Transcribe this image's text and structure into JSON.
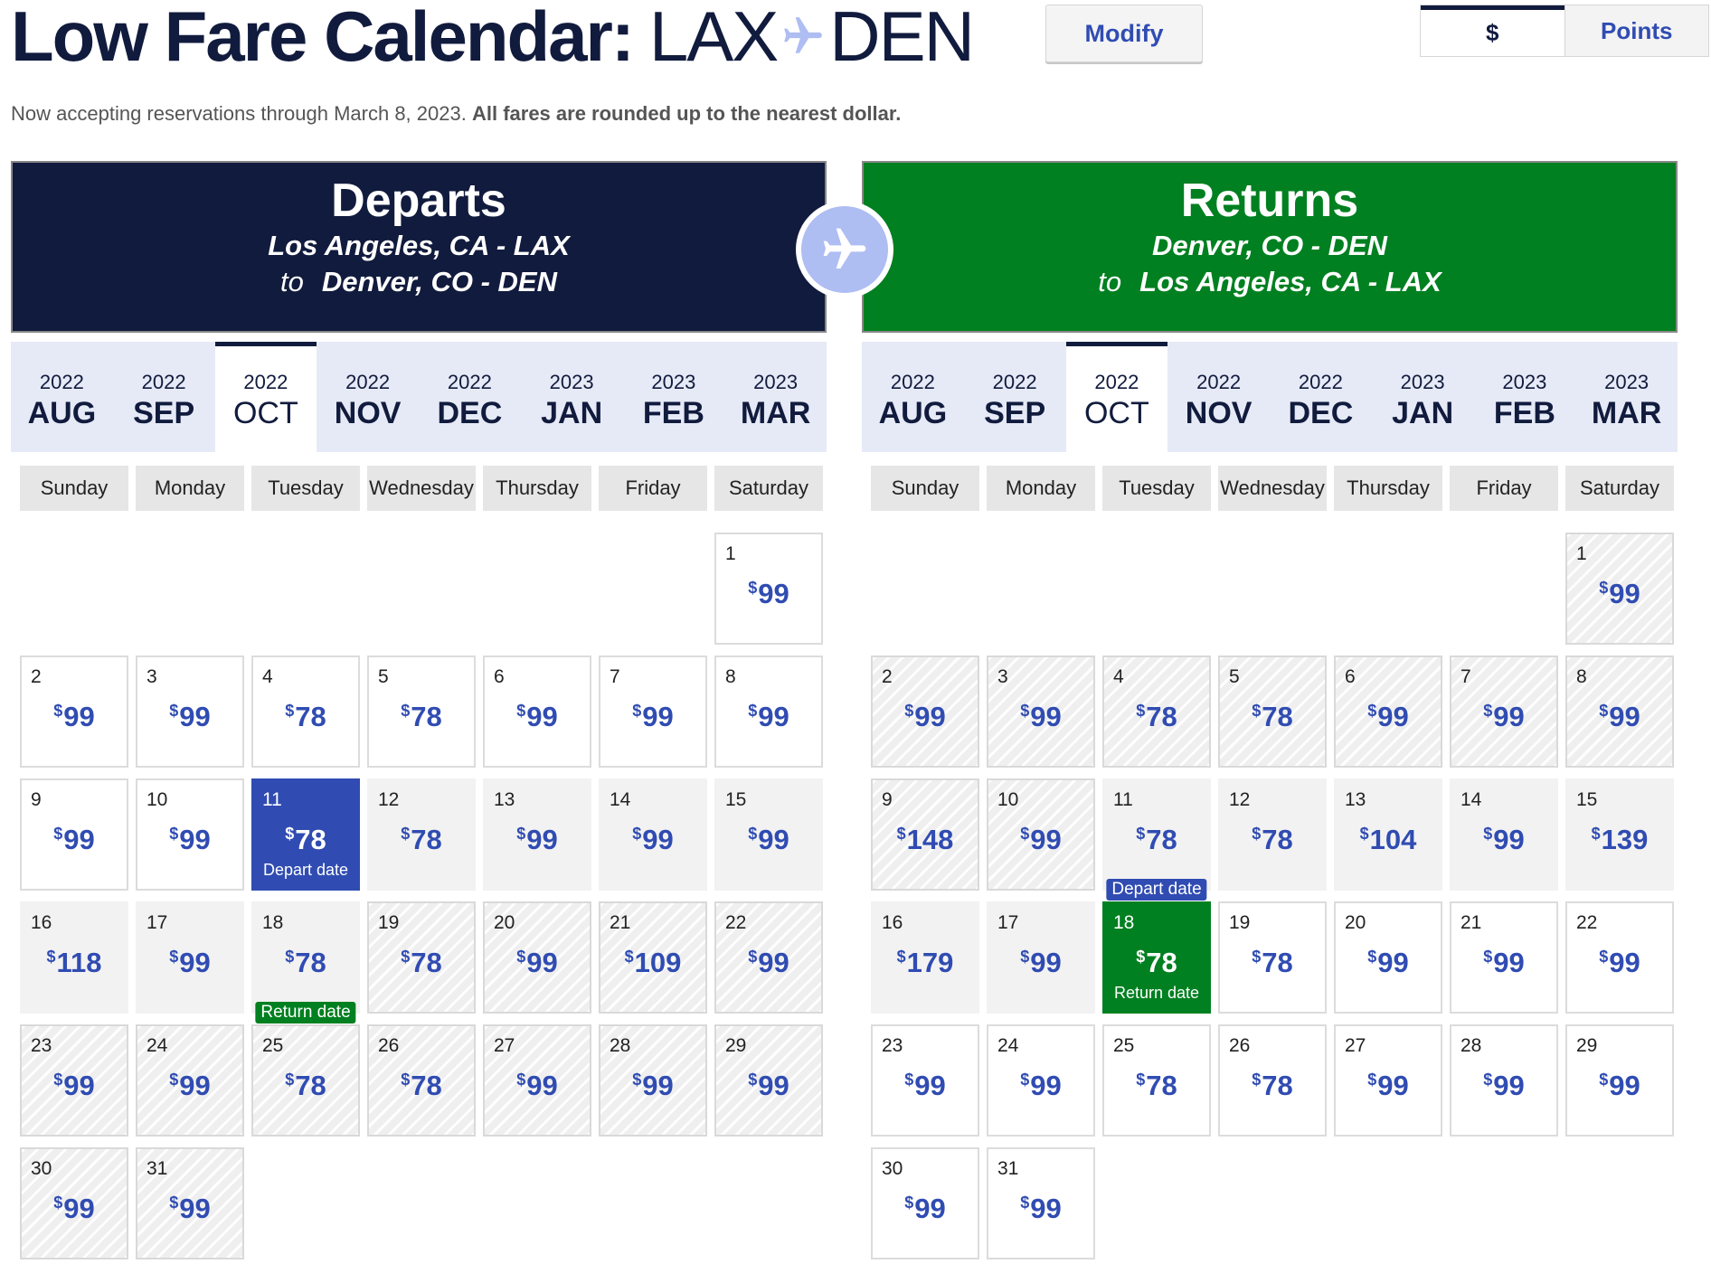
{
  "header": {
    "title_bold": "Low Fare Calendar:",
    "origin": "LAX",
    "destination": "DEN",
    "modify_label": "Modify",
    "toggle": {
      "dollars": "$",
      "points": "Points",
      "selected": "$"
    }
  },
  "notice": {
    "text": "Now accepting reservations through March 8, 2023.",
    "bold": "All fares are rounded up to the nearest dollar."
  },
  "colors": {
    "navy": "#111b3d",
    "blue": "#304cb2",
    "green": "#008020",
    "plane_circle": "#aebdf2"
  },
  "icons": {
    "title_plane": "plane-icon",
    "center_plane": "plane-icon"
  },
  "depart": {
    "heading": "Departs",
    "from": "Los Angeles, CA - LAX",
    "to_word": "to",
    "to": "Denver, CO - DEN"
  },
  "return": {
    "heading": "Returns",
    "from": "Denver, CO - DEN",
    "to_word": "to",
    "to": "Los Angeles, CA - LAX"
  },
  "months": [
    {
      "year": "2022",
      "month": "AUG"
    },
    {
      "year": "2022",
      "month": "SEP"
    },
    {
      "year": "2022",
      "month": "OCT",
      "active": true
    },
    {
      "year": "2022",
      "month": "NOV"
    },
    {
      "year": "2022",
      "month": "DEC"
    },
    {
      "year": "2023",
      "month": "JAN"
    },
    {
      "year": "2023",
      "month": "FEB"
    },
    {
      "year": "2023",
      "month": "MAR"
    }
  ],
  "weekdays": [
    "Sunday",
    "Monday",
    "Tuesday",
    "Wednesday",
    "Thursday",
    "Friday",
    "Saturday"
  ],
  "currency_symbol": "$",
  "depart_label": "Depart date",
  "return_label": "Return date",
  "depart_days": [
    {
      "day": "1",
      "price": "99",
      "style": "plain"
    },
    {
      "day": "2",
      "price": "99",
      "style": "plain"
    },
    {
      "day": "3",
      "price": "99",
      "style": "plain"
    },
    {
      "day": "4",
      "price": "78",
      "style": "plain"
    },
    {
      "day": "5",
      "price": "78",
      "style": "plain"
    },
    {
      "day": "6",
      "price": "99",
      "style": "plain"
    },
    {
      "day": "7",
      "price": "99",
      "style": "plain"
    },
    {
      "day": "8",
      "price": "99",
      "style": "plain"
    },
    {
      "day": "9",
      "price": "99",
      "style": "plain"
    },
    {
      "day": "10",
      "price": "99",
      "style": "plain"
    },
    {
      "day": "11",
      "price": "78",
      "style": "sel-dep",
      "label": "Depart date"
    },
    {
      "day": "12",
      "price": "78",
      "style": "band"
    },
    {
      "day": "13",
      "price": "99",
      "style": "band"
    },
    {
      "day": "14",
      "price": "99",
      "style": "band"
    },
    {
      "day": "15",
      "price": "99",
      "style": "band"
    },
    {
      "day": "16",
      "price": "118",
      "style": "band"
    },
    {
      "day": "17",
      "price": "99",
      "style": "band"
    },
    {
      "day": "18",
      "price": "78",
      "style": "band",
      "tag": "Return date",
      "tag_color": "green"
    },
    {
      "day": "19",
      "price": "78",
      "style": "hatched"
    },
    {
      "day": "20",
      "price": "99",
      "style": "hatched"
    },
    {
      "day": "21",
      "price": "109",
      "style": "hatched"
    },
    {
      "day": "22",
      "price": "99",
      "style": "hatched"
    },
    {
      "day": "23",
      "price": "99",
      "style": "hatched"
    },
    {
      "day": "24",
      "price": "99",
      "style": "hatched"
    },
    {
      "day": "25",
      "price": "78",
      "style": "hatched"
    },
    {
      "day": "26",
      "price": "78",
      "style": "hatched"
    },
    {
      "day": "27",
      "price": "99",
      "style": "hatched"
    },
    {
      "day": "28",
      "price": "99",
      "style": "hatched"
    },
    {
      "day": "29",
      "price": "99",
      "style": "hatched"
    },
    {
      "day": "30",
      "price": "99",
      "style": "hatched"
    },
    {
      "day": "31",
      "price": "99",
      "style": "hatched"
    }
  ],
  "return_days": [
    {
      "day": "1",
      "price": "99",
      "style": "hatched"
    },
    {
      "day": "2",
      "price": "99",
      "style": "hatched"
    },
    {
      "day": "3",
      "price": "99",
      "style": "hatched"
    },
    {
      "day": "4",
      "price": "78",
      "style": "hatched"
    },
    {
      "day": "5",
      "price": "78",
      "style": "hatched"
    },
    {
      "day": "6",
      "price": "99",
      "style": "hatched"
    },
    {
      "day": "7",
      "price": "99",
      "style": "hatched"
    },
    {
      "day": "8",
      "price": "99",
      "style": "hatched"
    },
    {
      "day": "9",
      "price": "148",
      "style": "hatched"
    },
    {
      "day": "10",
      "price": "99",
      "style": "hatched"
    },
    {
      "day": "11",
      "price": "78",
      "style": "band",
      "tag": "Depart date",
      "tag_color": "blue"
    },
    {
      "day": "12",
      "price": "78",
      "style": "band"
    },
    {
      "day": "13",
      "price": "104",
      "style": "band"
    },
    {
      "day": "14",
      "price": "99",
      "style": "band"
    },
    {
      "day": "15",
      "price": "139",
      "style": "band"
    },
    {
      "day": "16",
      "price": "179",
      "style": "band"
    },
    {
      "day": "17",
      "price": "99",
      "style": "band"
    },
    {
      "day": "18",
      "price": "78",
      "style": "sel-ret",
      "label": "Return date"
    },
    {
      "day": "19",
      "price": "78",
      "style": "plain"
    },
    {
      "day": "20",
      "price": "99",
      "style": "plain"
    },
    {
      "day": "21",
      "price": "99",
      "style": "plain"
    },
    {
      "day": "22",
      "price": "99",
      "style": "plain"
    },
    {
      "day": "23",
      "price": "99",
      "style": "plain"
    },
    {
      "day": "24",
      "price": "99",
      "style": "plain"
    },
    {
      "day": "25",
      "price": "78",
      "style": "plain"
    },
    {
      "day": "26",
      "price": "78",
      "style": "plain"
    },
    {
      "day": "27",
      "price": "99",
      "style": "plain"
    },
    {
      "day": "28",
      "price": "99",
      "style": "plain"
    },
    {
      "day": "29",
      "price": "99",
      "style": "plain"
    },
    {
      "day": "30",
      "price": "99",
      "style": "plain"
    },
    {
      "day": "31",
      "price": "99",
      "style": "plain"
    }
  ]
}
